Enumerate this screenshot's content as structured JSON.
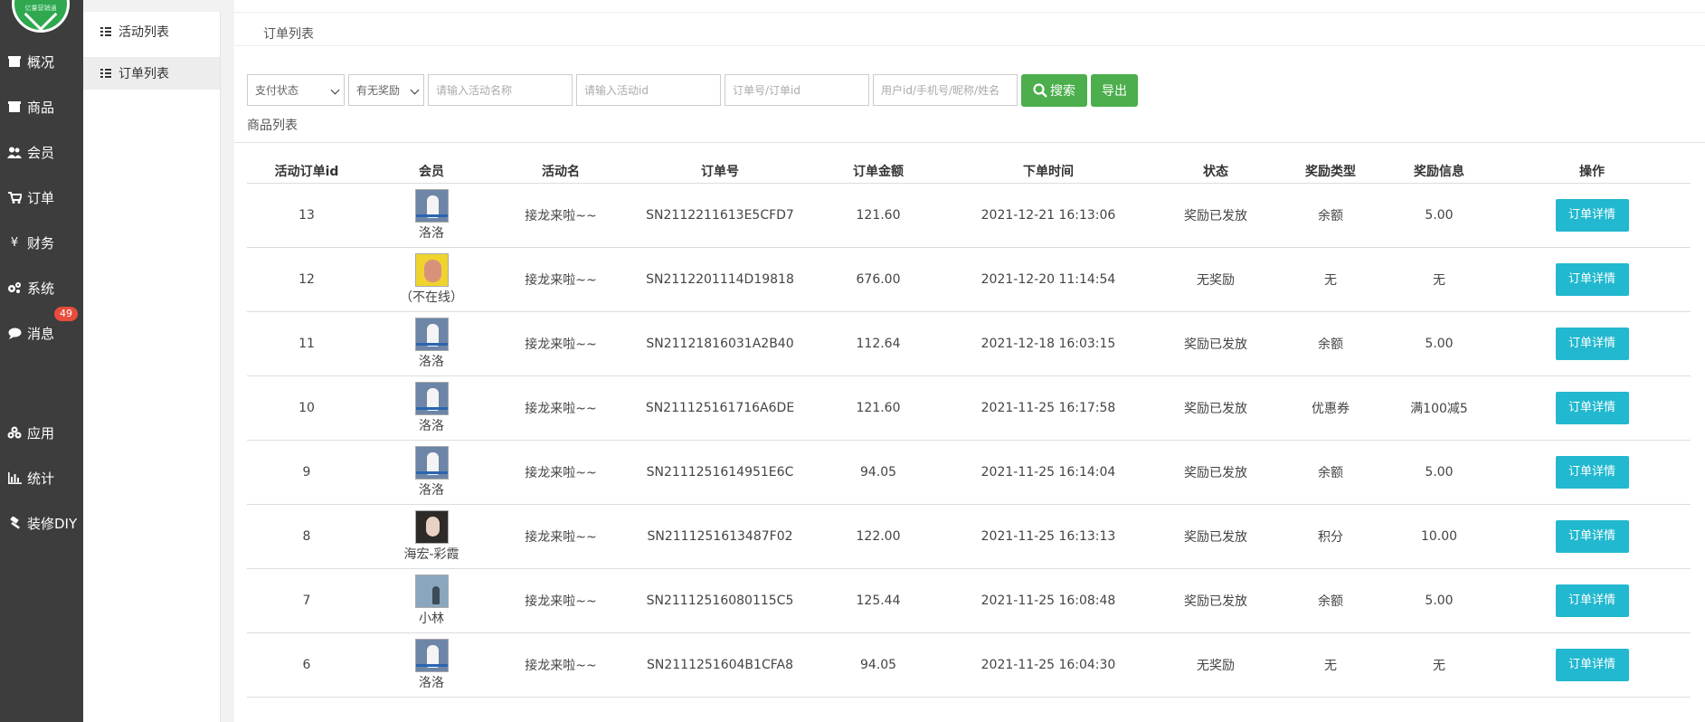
{
  "nav": {
    "logo_text": "亿量营销通",
    "items": [
      {
        "label": "概况",
        "icon": "overview-icon"
      },
      {
        "label": "商品",
        "icon": "goods-icon"
      },
      {
        "label": "会员",
        "icon": "members-icon"
      },
      {
        "label": "订单",
        "icon": "cart-icon"
      },
      {
        "label": "财务",
        "icon": "yen-icon"
      },
      {
        "label": "系统",
        "icon": "gears-icon"
      },
      {
        "label": "消息",
        "icon": "chat-icon",
        "badge": "49"
      },
      {
        "label": "应用",
        "icon": "apps-icon"
      },
      {
        "label": "统计",
        "icon": "bar-chart-icon"
      },
      {
        "label": "装修DIY",
        "icon": "hammer-icon"
      }
    ]
  },
  "subnav": {
    "items": [
      {
        "label": "活动列表"
      },
      {
        "label": "订单列表"
      }
    ]
  },
  "breadcrumb": "订单列表",
  "filters": {
    "pay_status": "支付状态",
    "reward": "有无奖励",
    "activity_name_placeholder": "请输入活动名称",
    "activity_id_placeholder": "请输入活动id",
    "order_placeholder": "订单号/订单id",
    "user_placeholder": "用户id/手机号/昵称/姓名",
    "search_label": "搜索",
    "export_label": "导出"
  },
  "section_title": "商品列表",
  "table": {
    "headers": [
      "活动订单id",
      "会员",
      "活动名",
      "订单号",
      "订单金额",
      "下单时间",
      "状态",
      "奖励类型",
      "奖励信息",
      "操作"
    ],
    "rows": [
      {
        "id": "13",
        "member": "洛洛",
        "activity": "接龙来啦~~",
        "order_no": "SN2112211613E5CFD7",
        "amount": "121.60",
        "time": "2021-12-21 16:13:06",
        "status": "奖励已发放",
        "reward_type": "余额",
        "reward_info": "5.00",
        "action": "订单详情"
      },
      {
        "id": "12",
        "member": "（不在线）",
        "activity": "接龙来啦~~",
        "order_no": "SN2112201114D19818",
        "amount": "676.00",
        "time": "2021-12-20 11:14:54",
        "status": "无奖励",
        "reward_type": "无",
        "reward_info": "无",
        "action": "订单详情"
      },
      {
        "id": "11",
        "member": "洛洛",
        "activity": "接龙来啦~~",
        "order_no": "SN21121816031A2B40",
        "amount": "112.64",
        "time": "2021-12-18 16:03:15",
        "status": "奖励已发放",
        "reward_type": "余额",
        "reward_info": "5.00",
        "action": "订单详情"
      },
      {
        "id": "10",
        "member": "洛洛",
        "activity": "接龙来啦~~",
        "order_no": "SN211125161716A6DE",
        "amount": "121.60",
        "time": "2021-11-25 16:17:58",
        "status": "奖励已发放",
        "reward_type": "优惠券",
        "reward_info": "满100减5",
        "action": "订单详情"
      },
      {
        "id": "9",
        "member": "洛洛",
        "activity": "接龙来啦~~",
        "order_no": "SN2111251614951E6C",
        "amount": "94.05",
        "time": "2021-11-25 16:14:04",
        "status": "奖励已发放",
        "reward_type": "余额",
        "reward_info": "5.00",
        "action": "订单详情"
      },
      {
        "id": "8",
        "member": "海宏-彩霞",
        "activity": "接龙来啦~~",
        "order_no": "SN2111251613487F02",
        "amount": "122.00",
        "time": "2021-11-25 16:13:13",
        "status": "奖励已发放",
        "reward_type": "积分",
        "reward_info": "10.00",
        "action": "订单详情"
      },
      {
        "id": "7",
        "member": "小林",
        "activity": "接龙来啦~~",
        "order_no": "SN21112516080115C5",
        "amount": "125.44",
        "time": "2021-11-25 16:08:48",
        "status": "奖励已发放",
        "reward_type": "余额",
        "reward_info": "5.00",
        "action": "订单详情"
      },
      {
        "id": "6",
        "member": "洛洛",
        "activity": "接龙来啦~~",
        "order_no": "SN2111251604B1CFA8",
        "amount": "94.05",
        "time": "2021-11-25 16:04:30",
        "status": "无奖励",
        "reward_type": "无",
        "reward_info": "无",
        "action": "订单详情"
      }
    ]
  }
}
